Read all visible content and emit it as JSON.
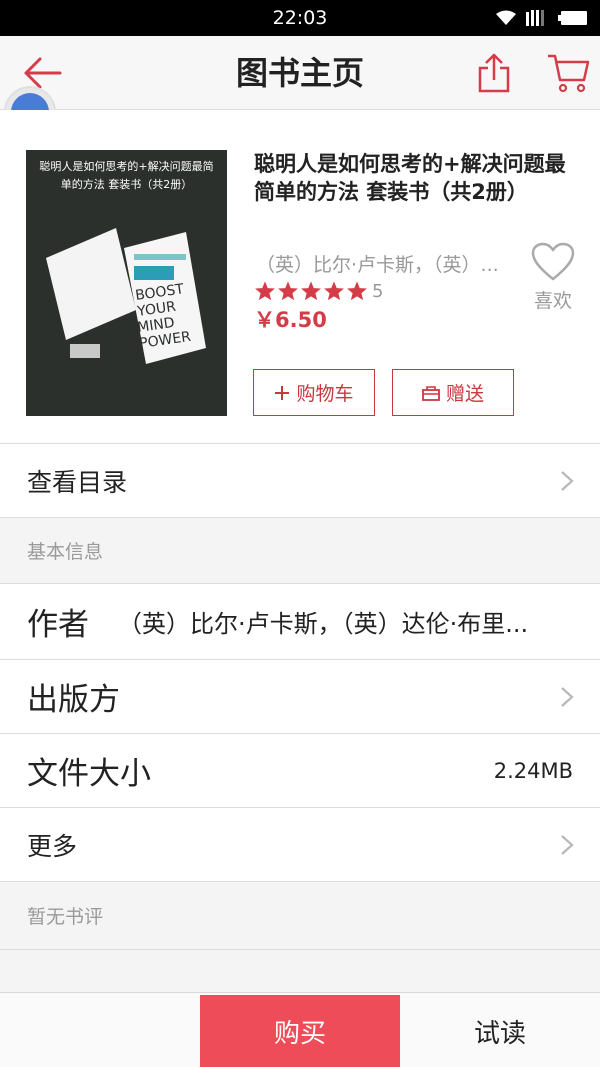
{
  "status_bar": {
    "time": "22:03"
  },
  "header": {
    "title": "图书主页"
  },
  "book": {
    "cover_text": "聪明人是如何思考的+解决问题最简单的方法 套装书（共2册）",
    "title": "聪明人是如何思考的+解决问题最简单的方法 套装书（共2册）",
    "authors": "（英）比尔·卢卡斯，（英）...",
    "rating_stars": 5,
    "rating_count": "5",
    "price": "￥6.50",
    "like_label": "喜欢",
    "add_cart_label": "购物车",
    "gift_label": "赠送"
  },
  "rows": {
    "catalog": "查看目录",
    "basic_info_header": "基本信息",
    "author_label": "作者",
    "author_value": "（英）比尔·卢卡斯，（英）达伦·布里...",
    "publisher_label": "出版方",
    "filesize_label": "文件大小",
    "filesize_value": "2.24MB",
    "more_label": "更多",
    "reviews_header": "暂无书评"
  },
  "bottom_bar": {
    "buy_label": "购买",
    "trial_label": "试读"
  },
  "colors": {
    "accent": "#d43d48",
    "buy_button": "#ef4c59",
    "star": "#d43d48"
  },
  "icons": [
    "back-arrow-icon",
    "share-icon",
    "cart-icon",
    "heart-icon",
    "plus-icon",
    "gift-icon",
    "chevron-right-icon",
    "wifi-icon",
    "signal-icon",
    "battery-icon",
    "star-icon"
  ]
}
